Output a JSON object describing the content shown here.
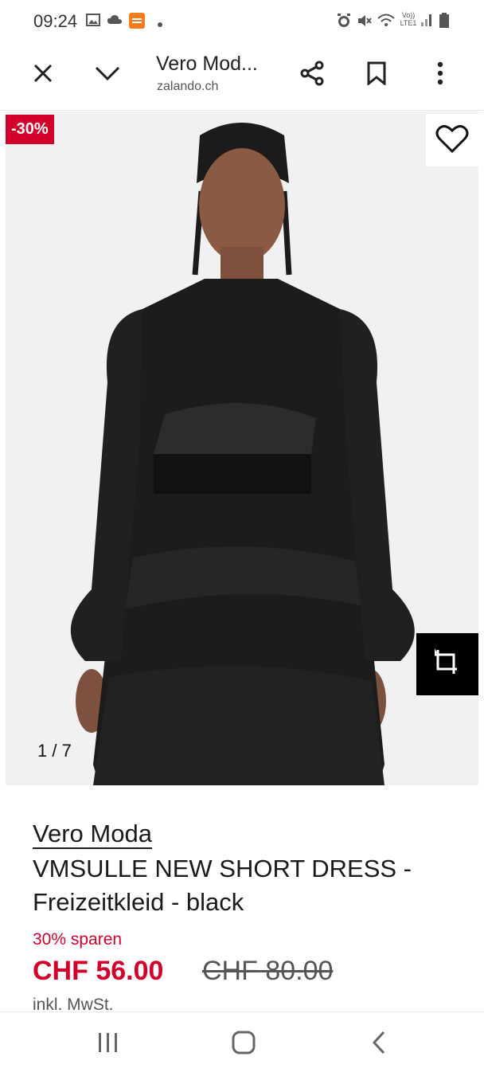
{
  "status_bar": {
    "time": "09:24",
    "left_icons": [
      "image-icon",
      "cloud-icon",
      "temu-app-icon",
      "dot-icon"
    ],
    "right_icons": [
      "alarm-icon",
      "mute-icon",
      "wifi-icon",
      "volte-icon",
      "signal-icon",
      "battery-icon"
    ],
    "volte_label": "Vo)) LTE1"
  },
  "toolbar": {
    "title": "Vero Mod...",
    "domain": "zalando.ch",
    "icons": [
      "close-icon",
      "chevron-down-icon",
      "share-icon",
      "bookmark-icon",
      "more-vert-icon"
    ]
  },
  "product_image": {
    "discount_badge": "-30%",
    "counter": "1 / 7",
    "icons": [
      "heart-icon",
      "crop-icon"
    ]
  },
  "product": {
    "brand": "Vero Moda",
    "name": "VMSULLE NEW SHORT DRESS - Freizeitkleid - black",
    "savings": "30% sparen",
    "price_current": "CHF 56.00",
    "price_old": "CHF 80.00",
    "vat": "inkl. MwSt."
  },
  "nav_bar": {
    "icons": [
      "recent-apps-icon",
      "home-icon",
      "back-icon"
    ]
  },
  "colors": {
    "accent_red": "#d3002b",
    "text": "#1a1a1a",
    "image_bg": "#f2f2f2"
  }
}
